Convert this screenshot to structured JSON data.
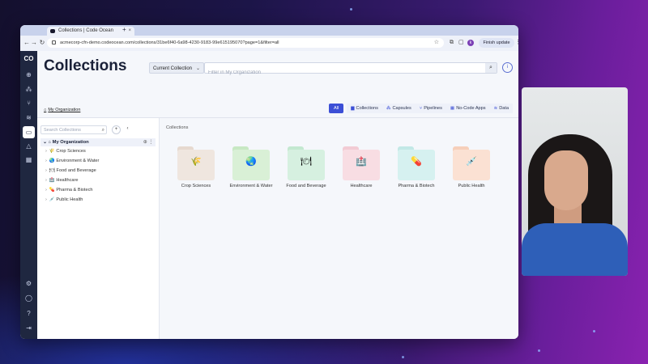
{
  "browser": {
    "tab_title": "Collections | Code Ocean",
    "new_tab": "+",
    "url": "acmecorp-cfn-demo.codeocean.com/collections/31be6f40-6a98-4230-9183-99e615195070?page=1&filter=all",
    "profile_initial": "k",
    "finish_update_label": "Finish update"
  },
  "app": {
    "logo": "CO",
    "page_title": "Collections",
    "collection_dropdown": "Current Collection",
    "search_placeholder": "Filter in My Organization",
    "breadcrumb": "My Organization",
    "filters": [
      {
        "label": "All",
        "icon": "",
        "active": true
      },
      {
        "label": "Collections",
        "icon": "▆"
      },
      {
        "label": "Capsules",
        "icon": "⁂"
      },
      {
        "label": "Pipelines",
        "icon": "⑂"
      },
      {
        "label": "No-Code Apps",
        "icon": "▦"
      },
      {
        "label": "Data",
        "icon": "≋"
      }
    ],
    "sidebar": {
      "search_placeholder": "Search Collections",
      "root_label": "My Organization",
      "items": [
        {
          "label": "Crop Sciences",
          "icon": "🌾"
        },
        {
          "label": "Environment & Water",
          "icon": "🌏"
        },
        {
          "label": "Food and Beverage",
          "icon": "🍽"
        },
        {
          "label": "Healthcare",
          "icon": "🏥"
        },
        {
          "label": "Pharma & Biotech",
          "icon": "💊"
        },
        {
          "label": "Public Health",
          "icon": "💉"
        }
      ]
    },
    "main": {
      "section_label": "Collections",
      "cards": [
        {
          "label": "Crop Sciences",
          "icon": "🌾",
          "color": "#efe6df",
          "tab": "#e6d9cf"
        },
        {
          "label": "Environment & Water",
          "icon": "🌏",
          "color": "#d9f0d6",
          "tab": "#c7e8c3"
        },
        {
          "label": "Food and Beverage",
          "icon": "🍽",
          "color": "#d6f0e0",
          "tab": "#c3e8d0"
        },
        {
          "label": "Healthcare",
          "icon": "🏥",
          "color": "#f8dde3",
          "tab": "#f2cbd4"
        },
        {
          "label": "Pharma & Biotech",
          "icon": "💊",
          "color": "#d6f1f0",
          "tab": "#c2e8e6"
        },
        {
          "label": "Public Health",
          "icon": "💉",
          "color": "#fbe1d3",
          "tab": "#f6cfba"
        }
      ]
    }
  },
  "colors": {
    "accent": "#3c4fd6",
    "rail": "#1f2740"
  }
}
